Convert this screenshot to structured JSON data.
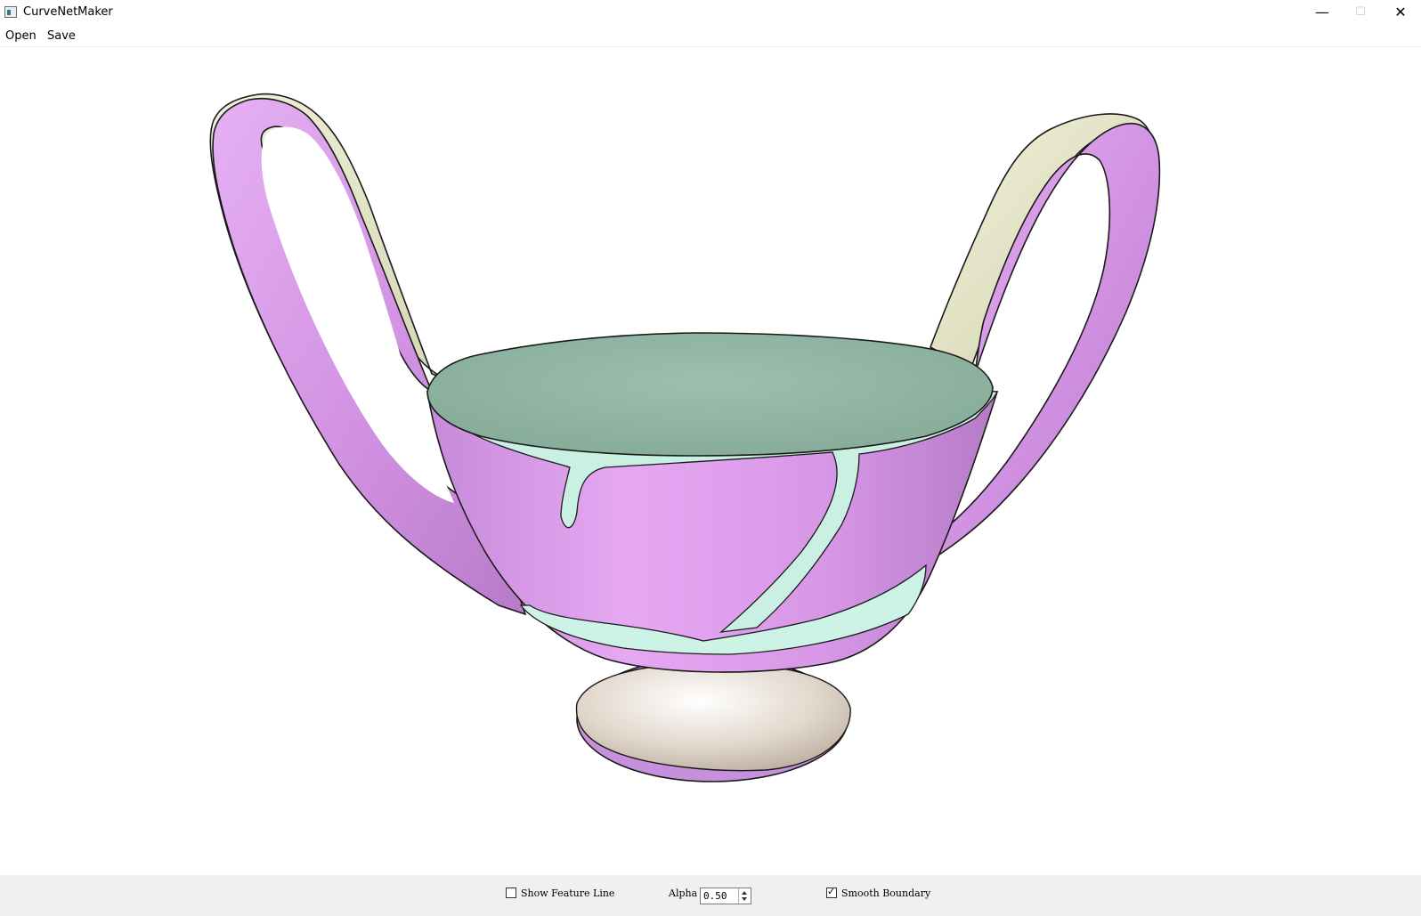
{
  "window": {
    "title": "CurveNetMaker",
    "minimize": "—",
    "maximize": "☐",
    "close": "✕"
  },
  "menu": {
    "items": [
      "Open",
      "Save"
    ]
  },
  "viewport": {
    "colors": {
      "handle_purple": "#d99ae6",
      "handle_light": "#e3e3c4",
      "top_face": "#93b8a6",
      "seam_mint": "#c9f0e2",
      "foot": "#ddd3c8",
      "boundary": "#1a1a1a"
    }
  },
  "controls": {
    "show_feature_line": {
      "label": "Show Feature Line",
      "checked": false
    },
    "alpha": {
      "label": "Alpha",
      "value": "0.50"
    },
    "smooth_boundary": {
      "label": "Smooth Boundary",
      "checked": true
    }
  }
}
